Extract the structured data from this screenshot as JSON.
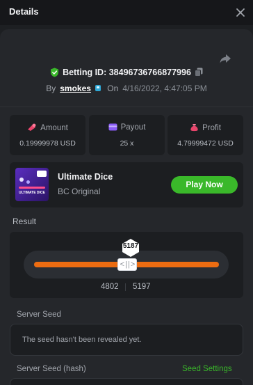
{
  "header": {
    "title": "Details"
  },
  "bet": {
    "id_label": "Betting ID:",
    "id_value": "38496736766877996",
    "by_label": "By",
    "username": "smokes",
    "on_label": "On",
    "date": "4/16/2022, 4:47:05 PM"
  },
  "stats": {
    "amount": {
      "label": "Amount",
      "value": "0.19999978 USD"
    },
    "payout": {
      "label": "Payout",
      "value": "25 x"
    },
    "profit": {
      "label": "Profit",
      "value": "4.79999472 USD"
    }
  },
  "game": {
    "name": "Ultimate Dice",
    "provider": "BC Original",
    "thumb_text": "ULTIMATE DICE",
    "play_label": "Play Now"
  },
  "result": {
    "label": "Result",
    "roll": "5187",
    "range_min": "4802",
    "range_max": "5197",
    "handle_glyph": "< | | >"
  },
  "seeds": {
    "server_seed_label": "Server Seed",
    "server_seed_text": "The seed hasn't been revealed yet.",
    "hash_label": "Server Seed (hash)",
    "settings_link": "Seed Settings"
  },
  "colors": {
    "accent_green": "#3ab82a",
    "track_orange": "#ec6c11",
    "amount_icon": "#e8456b",
    "payout_icon": "#8a5cf6",
    "profit_icon": "#e8456b"
  },
  "icons": {
    "close": "close-icon",
    "share": "share-icon",
    "shield": "shield-check-icon",
    "copy": "copy-icon",
    "user_badge": "user-badge-icon",
    "amount": "coins-icon",
    "payout": "wallet-icon",
    "profit": "money-bag-icon"
  }
}
